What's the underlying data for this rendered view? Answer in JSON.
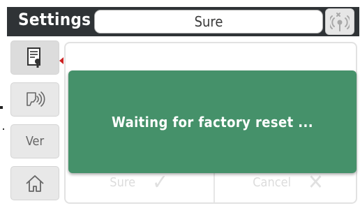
{
  "header": {
    "title": "Settings",
    "tab_label": "Sure",
    "signal_icon": "no-signal-antenna-icon"
  },
  "sidebar": {
    "items": [
      {
        "icon": "document-settings-icon",
        "active": true
      },
      {
        "icon": "voice-icon"
      },
      {
        "label": "Ver"
      },
      {
        "icon": "home-icon"
      }
    ]
  },
  "content": {
    "confirm_label": "Sure",
    "cancel_label": "Cancel"
  },
  "dialog": {
    "message": "Waiting for factory reset ...",
    "background": "#45916a"
  }
}
